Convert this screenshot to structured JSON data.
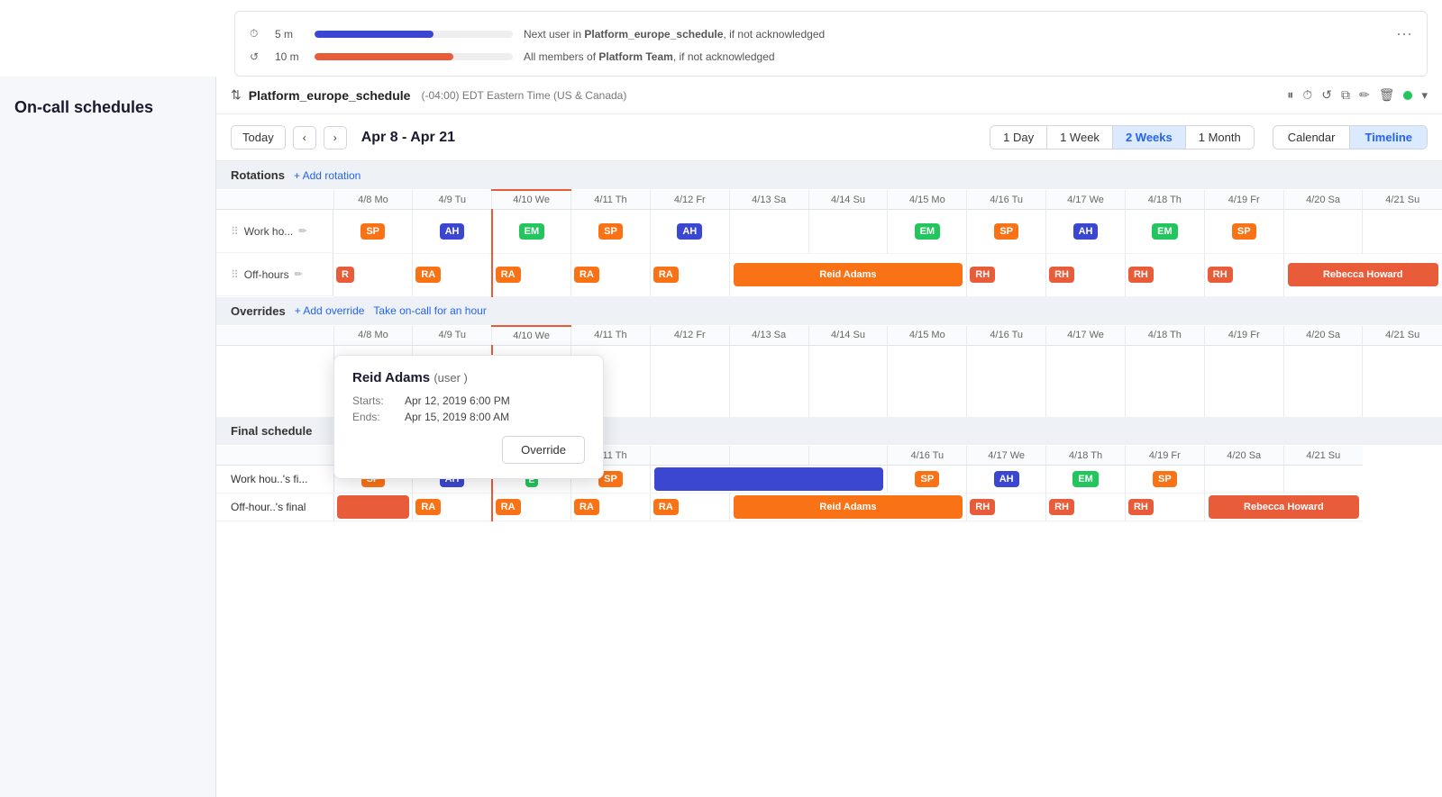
{
  "sidebar": {
    "title": "On-call schedules"
  },
  "escalation": {
    "rows": [
      {
        "icon": "⏱",
        "time": "5 m",
        "barWidth": "60%",
        "barColor": "blue",
        "text": "Next user in",
        "bold": "Platform_europe_schedule",
        "suffix": ", if not acknowledged"
      },
      {
        "icon": "↺",
        "time": "10 m",
        "barWidth": "70%",
        "barColor": "red",
        "text": "All members of",
        "bold": "Platform Team",
        "suffix": ", if not acknowledged"
      }
    ]
  },
  "schedule": {
    "sortIcon": "⇅",
    "name": "Platform_europe_schedule",
    "timezone": "(-04:00) EDT Eastern Time (US & Canada)",
    "actions": {
      "pause": "⏸",
      "clock": "⏱",
      "rotate": "↺",
      "copy": "⧉",
      "edit": "✏",
      "delete": "🗑"
    }
  },
  "toolbar": {
    "todayLabel": "Today",
    "prevLabel": "‹",
    "nextLabel": "›",
    "dateRange": "Apr 8 - Apr 21",
    "viewButtons": [
      {
        "label": "1 Day",
        "active": false
      },
      {
        "label": "1 Week",
        "active": false
      },
      {
        "label": "2 Weeks",
        "active": true
      },
      {
        "label": "1 Month",
        "active": false
      }
    ],
    "displayButtons": [
      {
        "label": "Calendar",
        "active": false
      },
      {
        "label": "Timeline",
        "active": true
      }
    ]
  },
  "rotations": {
    "sectionTitle": "Rotations",
    "addLabel": "+ Add rotation",
    "rows": [
      {
        "name": "Work ho...",
        "hasEdit": true
      },
      {
        "name": "Off-hours",
        "hasEdit": true
      }
    ]
  },
  "overrides": {
    "sectionTitle": "Overrides",
    "addLabel": "+ Add override",
    "takeLabel": "Take on-call for an hour"
  },
  "finalSchedule": {
    "sectionTitle": "Final schedule",
    "rows": [
      {
        "name": "Work hou..'s fi..."
      },
      {
        "name": "Off-hour..'s final"
      }
    ]
  },
  "columns": [
    {
      "label": "4/8 Mo",
      "isToday": false
    },
    {
      "label": "4/9 Tu",
      "isToday": false
    },
    {
      "label": "4/10 We",
      "isToday": true
    },
    {
      "label": "4/11 Th",
      "isToday": false
    },
    {
      "label": "4/12 Fr",
      "isToday": false
    },
    {
      "label": "4/13 Sa",
      "isToday": false
    },
    {
      "label": "4/14 Su",
      "isToday": false
    },
    {
      "label": "4/15 Mo",
      "isToday": false
    },
    {
      "label": "4/16 Tu",
      "isToday": false
    },
    {
      "label": "4/17 We",
      "isToday": false
    },
    {
      "label": "4/18 Th",
      "isToday": false
    },
    {
      "label": "4/19 Fr",
      "isToday": false
    },
    {
      "label": "4/20 Sa",
      "isToday": false
    },
    {
      "label": "4/21 Su",
      "isToday": false
    }
  ],
  "tooltip": {
    "title": "Reid Adams",
    "subtitle": "(user )",
    "startsLabel": "Starts:",
    "startsValue": "Apr 12, 2019 6:00 PM",
    "endsLabel": "Ends:",
    "endsValue": "Apr 15, 2019 8:00 AM",
    "overrideBtn": "Override"
  },
  "colors": {
    "sp": "#f97316",
    "ah": "#3b46d1",
    "em": "#22c55e",
    "r": "#e85c3a",
    "ra": "#f97316",
    "rh": "#e85c3a",
    "reidAdams": "#f97316",
    "rebeccaHoward": "#e85c3a",
    "todayLine": "#e85c3a",
    "sectionBg": "#eef2f7",
    "activeBtnBg": "#dbeafe",
    "activeBtnColor": "#2563eb"
  }
}
